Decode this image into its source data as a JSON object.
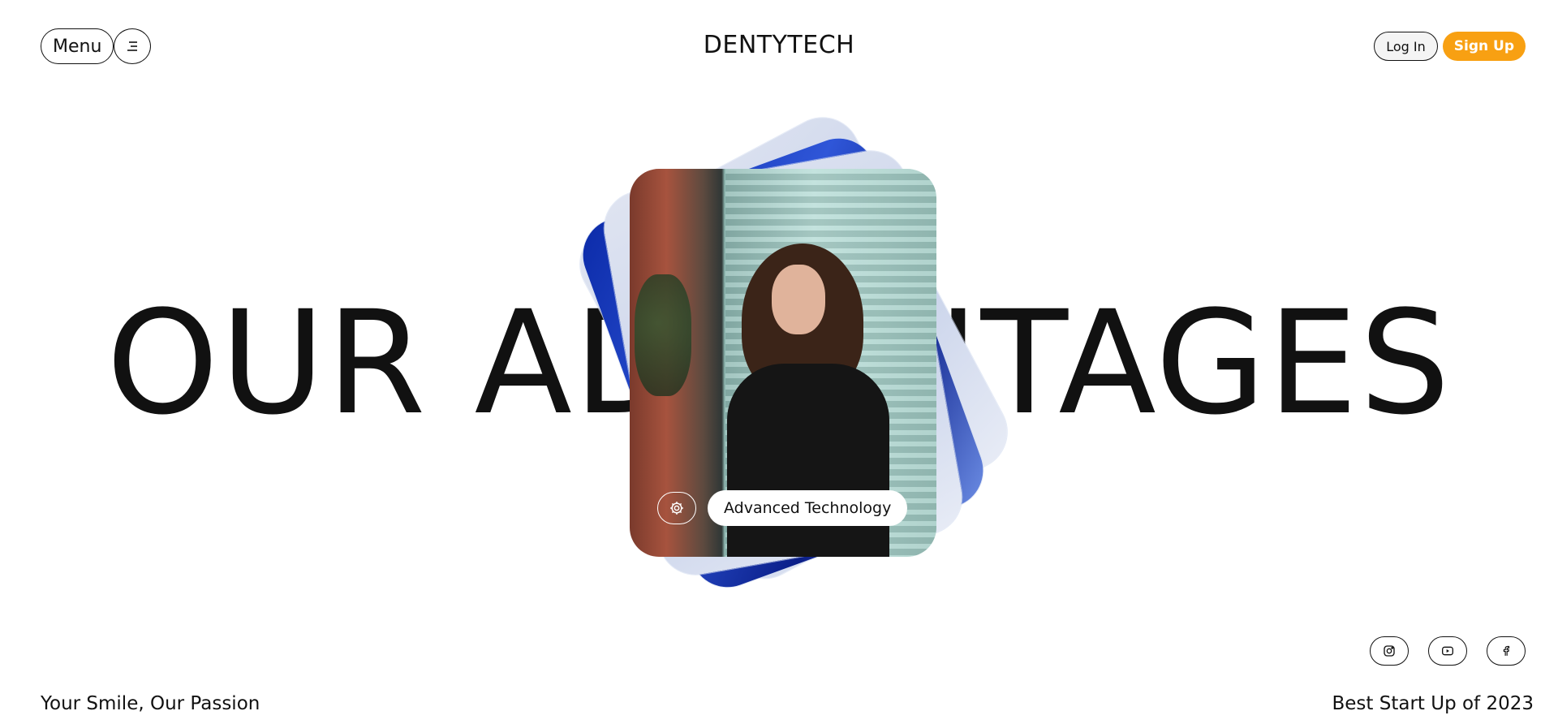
{
  "header": {
    "menu_label": "Menu",
    "brand": "DENTYTECH",
    "login_label": "Log In",
    "signup_label": "Sign Up"
  },
  "hero": {
    "heading": "OUR ADVANTAGES"
  },
  "card": {
    "label": "Advanced Technology",
    "icon": "gear-icon"
  },
  "footer": {
    "tagline": "Your Smile, Our Passion",
    "award": "Best Start Up of 2023",
    "socials": [
      "instagram-icon",
      "youtube-icon",
      "facebook-icon"
    ]
  },
  "colors": {
    "accent": "#f8a012",
    "text": "#111111",
    "background": "#ffffff"
  }
}
